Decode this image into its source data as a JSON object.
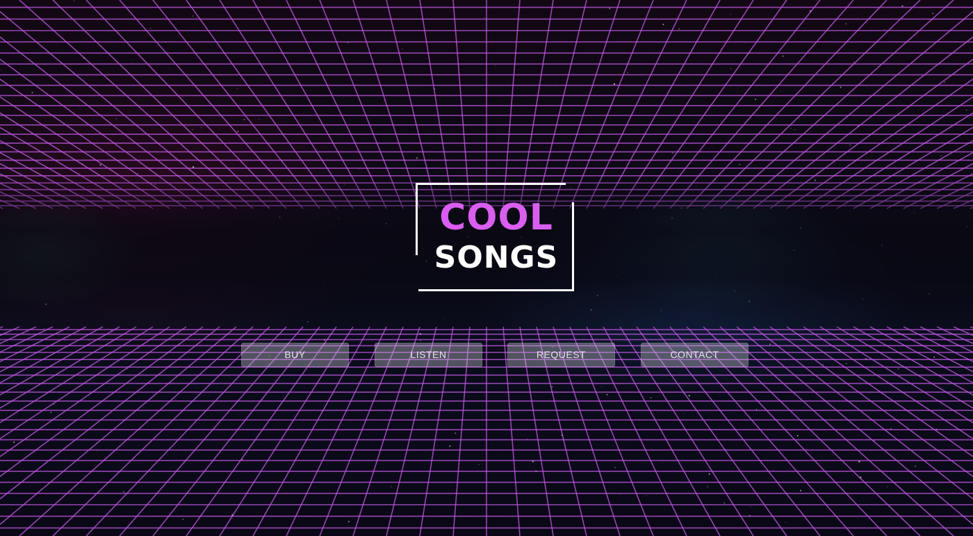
{
  "logo": {
    "line1": "COOL",
    "line2": "SONGS"
  },
  "nav": {
    "items": [
      {
        "label": "BUY"
      },
      {
        "label": "LISTEN"
      },
      {
        "label": "REQUEST"
      },
      {
        "label": "CONTACT"
      }
    ]
  },
  "colors": {
    "accent": "#d95ef0",
    "grid": "#c55ae8",
    "logo_text": "#ffffff",
    "button_bg": "rgba(200,200,210,0.38)",
    "background": "#0a0a14"
  }
}
